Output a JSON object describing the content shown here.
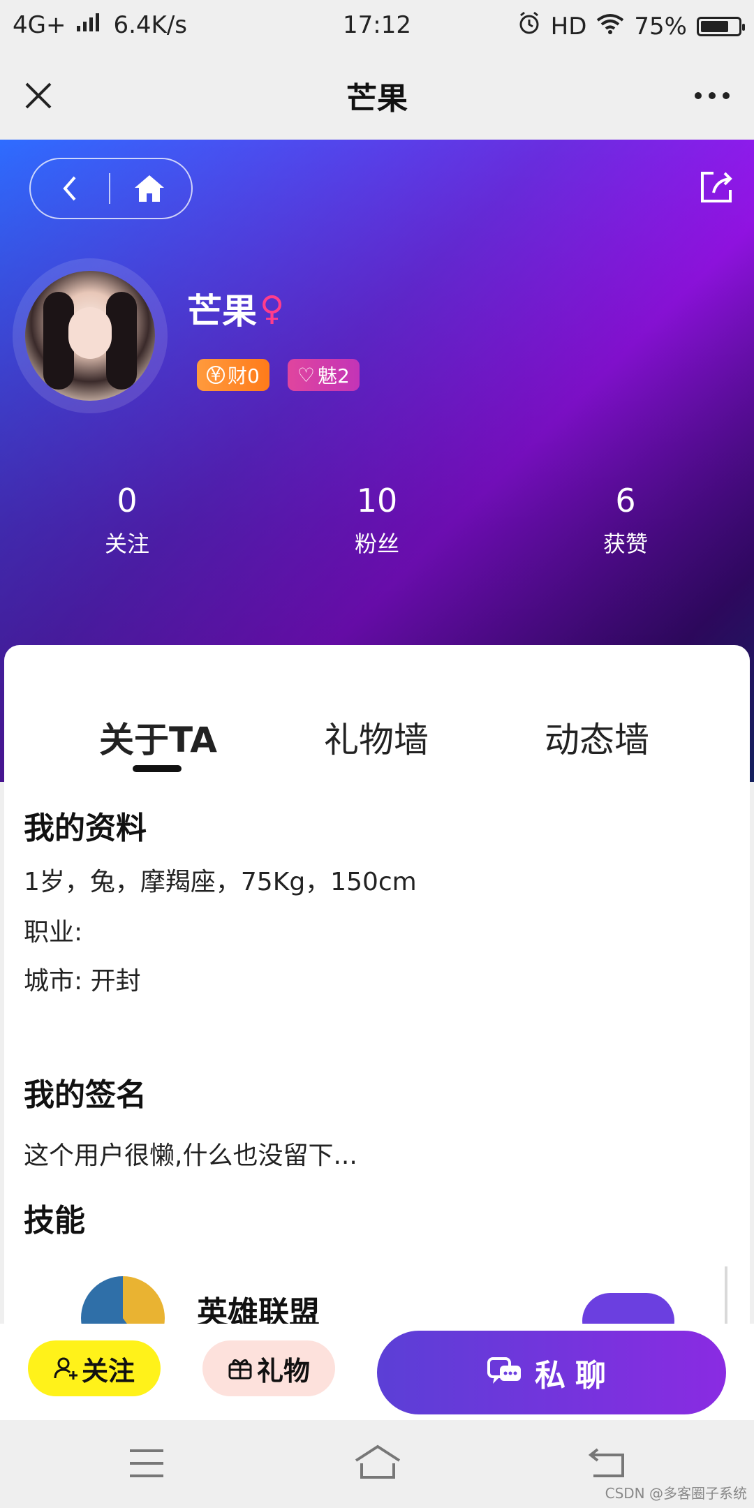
{
  "status_bar": {
    "network": "4G+",
    "speed": "6.4K/s",
    "time": "17:12",
    "hd": "HD",
    "battery_text": "75%",
    "battery_level": 0.75
  },
  "title_bar": {
    "title": "芒果"
  },
  "profile": {
    "name": "芒果",
    "gender_symbol": "♀",
    "wealth_badge": "财0",
    "charm_badge": "魅2",
    "stats": [
      {
        "value": "0",
        "label": "关注"
      },
      {
        "value": "10",
        "label": "粉丝"
      },
      {
        "value": "6",
        "label": "获赞"
      }
    ]
  },
  "tabs": [
    {
      "label": "关于TA",
      "active": true
    },
    {
      "label": "礼物墙",
      "active": false
    },
    {
      "label": "动态墙",
      "active": false
    }
  ],
  "about": {
    "profile_title": "我的资料",
    "profile_line": "1岁，兔，摩羯座，75Kg，150cm",
    "job_line": "职业:",
    "city_line": "城市:  开封",
    "signature_title": "我的签名",
    "signature_text": "这个用户很懒,什么也没留下...",
    "skills_title": "技能",
    "skills": [
      {
        "name": "英雄联盟"
      }
    ]
  },
  "actions": {
    "follow": "关注",
    "gift": "礼物",
    "chat": "私聊"
  },
  "watermark": "CSDN @多客圈子系统",
  "colors": {
    "follow_bg": "#fff21a",
    "gift_bg": "#fde1dc",
    "chat_bg": "#6b3fe0",
    "wealth_badge": "#ff8a2a",
    "charm_badge": "#d13cab",
    "gender": "#ff3d8b"
  }
}
